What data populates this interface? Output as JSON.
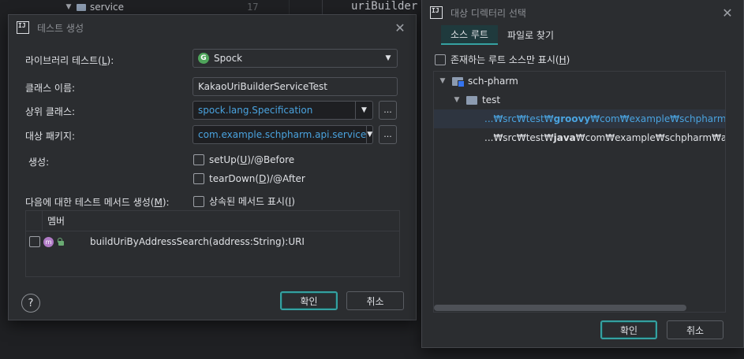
{
  "background": {
    "tree_item": "service",
    "line_number": "17",
    "code": "uriBuilder"
  },
  "create_test": {
    "title": "테스트 생성",
    "library_label": "라이브러리 테스트(",
    "library_mnemonic": "L",
    "library_suffix": "):",
    "library_value": "Spock",
    "class_name_label": "클래스 이름:",
    "class_name_value": "KakaoUriBuilderServiceTest",
    "superclass_label": "상위 클래스:",
    "superclass_value": "spock.lang.Specification",
    "package_label": "대상 패키지:",
    "package_value": "com.example.schpharm.api.service",
    "generate_label": "생성:",
    "setup_label_a": "setUp(",
    "setup_mnemonic": "U",
    "setup_label_b": ")/@Before",
    "teardown_label_a": "tearDown(",
    "teardown_mnemonic": "D",
    "teardown_label_b": ")/@After",
    "methods_label_a": "다음에 대한 테스트 메서드 생성(",
    "methods_mnemonic": "M",
    "methods_label_b": "):",
    "inherited_label_a": "상속된 메서드 표시(",
    "inherited_mnemonic": "I",
    "inherited_label_b": ")",
    "members_header": "멤버",
    "members": [
      {
        "signature": "buildUriByAddressSearch(address:String):URI"
      }
    ],
    "dots_label": "...",
    "help_label": "?",
    "ok_label": "확인",
    "cancel_label": "취소"
  },
  "dir_select": {
    "title": "대상 디렉터리 선택",
    "tabs": [
      {
        "label": "소스 루트"
      },
      {
        "label": "파일로 찾기"
      }
    ],
    "only_existing_a": "존재하는 루트 소스만 표시(",
    "only_existing_mnemonic": "H",
    "only_existing_b": ")",
    "tree": {
      "project": "sch-pharm",
      "module": "test",
      "root1_prefix": "...₩src₩test₩",
      "root1_bold": "groovy",
      "root1_suffix": "₩com₩example₩schpharm₩api₩",
      "root2_prefix": "...₩src₩test₩",
      "root2_bold": "java",
      "root2_suffix": "₩com₩example₩schpharm₩api₩ser"
    },
    "ok_label": "확인",
    "cancel_label": "취소"
  },
  "colors": {
    "accent": "#35a1a1",
    "link": "#4aa3df",
    "dialog_bg": "#2b2d30"
  }
}
